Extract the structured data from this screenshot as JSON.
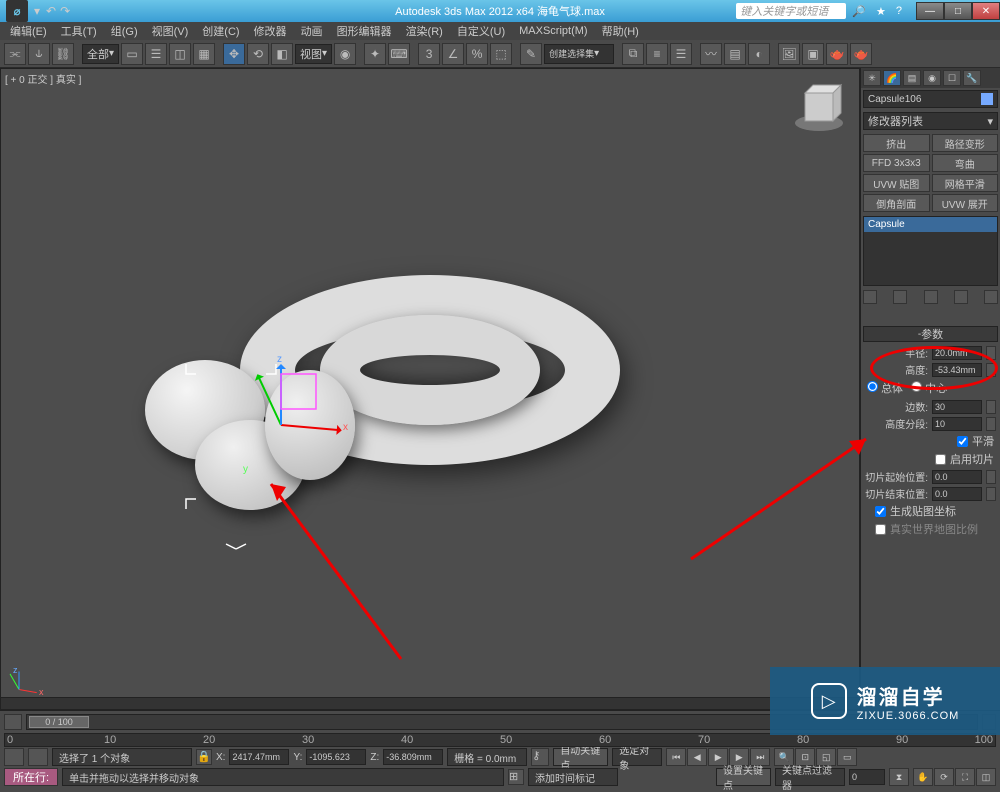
{
  "title": "Autodesk 3ds Max 2012 x64    海龟气球.max",
  "search_placeholder": "键入关键字或短语",
  "menu": [
    "编辑(E)",
    "工具(T)",
    "组(G)",
    "视图(V)",
    "创建(C)",
    "修改器",
    "动画",
    "图形编辑器",
    "渲染(R)",
    "自定义(U)",
    "MAXScript(M)",
    "帮助(H)"
  ],
  "toolbar_dropdown1": "全部",
  "toolbar_dropdown2": "视图",
  "toolbar_dropdown3": "创建选择集",
  "viewport_label": "[ + 0 正交 ] 真实 ]",
  "right": {
    "object_name": "Capsule106",
    "modifier_list": "修改器列表",
    "buttons": [
      "挤出",
      "路径变形",
      "FFD 3x3x3",
      "弯曲",
      "UVW 贴图",
      "网格平滑",
      "倒角剖面",
      "UVW 展开"
    ],
    "stack_current": "Capsule",
    "rollout_title": "参数",
    "radius_label": "半径:",
    "radius_value": "20.0mm",
    "height_label": "高度:",
    "height_value": "-53.43mm",
    "pivot_overall": "总体",
    "pivot_center": "中心",
    "sides_label": "边数:",
    "sides_value": "30",
    "hsegs_label": "高度分段:",
    "hsegs_value": "10",
    "smooth_label": "平滑",
    "slice_on_label": "启用切片",
    "slice_from_label": "切片起始位置:",
    "slice_from_value": "0.0",
    "slice_to_label": "切片结束位置:",
    "slice_to_value": "0.0",
    "gen_uv_label": "生成贴图坐标",
    "real_world_label": "真实世界地图比例"
  },
  "timeline": {
    "frame": "0 / 100"
  },
  "status": {
    "selected": "选择了 1 个对象",
    "hint": "单击并拖动以选择并移动对象",
    "x": "2417.47mm",
    "y": "-1095.623",
    "z": "-36.809mm",
    "grid": "栅格 = 0.0mm",
    "autokey": "自动关键点",
    "selset": "选定对象",
    "setkey": "设置关键点",
    "keyfilter": "关键点过滤器",
    "addtime": "添加时间标记",
    "locrow": "所在行:"
  },
  "watermark": {
    "brand": "溜溜自学",
    "url": "ZIXUE.3066.COM"
  }
}
